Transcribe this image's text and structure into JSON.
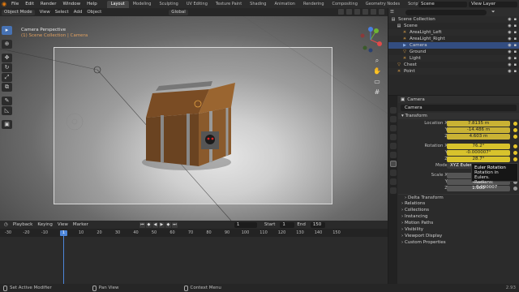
{
  "topbar": {
    "menus": [
      "File",
      "Edit",
      "Render",
      "Window",
      "Help"
    ],
    "workspaces": [
      "Layout",
      "Modeling",
      "Sculpting",
      "UV Editing",
      "Texture Paint",
      "Shading",
      "Animation",
      "Rendering",
      "Compositing",
      "Geometry Nodes",
      "Scripting"
    ],
    "active_workspace": "Layout",
    "scene": "Scene",
    "view_layer": "View Layer"
  },
  "viewport": {
    "mode": "Object Mode",
    "menus": [
      "View",
      "Select",
      "Add",
      "Object"
    ],
    "orientation": "Global",
    "info_title": "Camera Perspective",
    "info_sub": "(1) Scene Collection | Camera"
  },
  "timeline": {
    "menus": [
      "Playback",
      "Keying",
      "View",
      "Marker"
    ],
    "current_frame": "1",
    "start_label": "Start",
    "start": "1",
    "end_label": "End",
    "end": "150",
    "ruler": [
      "-30",
      "-20",
      "-10",
      "0",
      "10",
      "20",
      "30",
      "40",
      "50",
      "60",
      "70",
      "80",
      "90",
      "100",
      "110",
      "120",
      "130",
      "140",
      "150"
    ],
    "playhead": "1"
  },
  "statusbar": {
    "item1": "Set Active Modifier",
    "item2": "Pan View",
    "item3": "Context Menu",
    "version": "2.93"
  },
  "outliner": {
    "rows": [
      {
        "label": "Scene Collection",
        "indent": 0,
        "icon": "collection"
      },
      {
        "label": "Scene",
        "indent": 1,
        "icon": "collection"
      },
      {
        "label": "AreaLight_Left",
        "indent": 2,
        "icon": "light"
      },
      {
        "label": "AreaLight_Right",
        "indent": 2,
        "icon": "light"
      },
      {
        "label": "Camera",
        "indent": 2,
        "icon": "camera",
        "selected": true
      },
      {
        "label": "Ground",
        "indent": 2,
        "icon": "mesh"
      },
      {
        "label": "Light",
        "indent": 2,
        "icon": "light"
      },
      {
        "label": "Chest",
        "indent": 1,
        "icon": "mesh"
      },
      {
        "label": "Point",
        "indent": 1,
        "icon": "light"
      }
    ]
  },
  "properties": {
    "object_header": "Camera",
    "object_name": "Camera",
    "transform_label": "Transform",
    "location": {
      "label": "Location X",
      "x": "7.8135 m",
      "y_label": "Y",
      "y": "-14.486 m",
      "z_label": "Z",
      "z": "4.603 m"
    },
    "rotation": {
      "label": "Rotation X",
      "x": "76.2°",
      "y_label": "Y",
      "y": "-0.000007°",
      "z_label": "Z",
      "z": "28.7°"
    },
    "mode_label": "Mode",
    "mode_value": "XYZ Euler",
    "scale": {
      "label": "Scale X",
      "x": "1.000",
      "y_label": "Y",
      "y": "1.000",
      "z_label": "Z",
      "z": "1.000"
    },
    "delta_transform": "Delta Transform",
    "panels": [
      "Relations",
      "Collections",
      "Instancing",
      "Motion Paths",
      "Visibility",
      "Viewport Display",
      "Custom Properties"
    ]
  },
  "tooltip": {
    "title": "Euler Rotation",
    "line2": "Rotation in Eulers.",
    "line3": "Radians: -0.000007"
  },
  "colors": {
    "accent": "#4772b3",
    "keyframe": "#d8c32c",
    "animated": "#c9b234"
  }
}
